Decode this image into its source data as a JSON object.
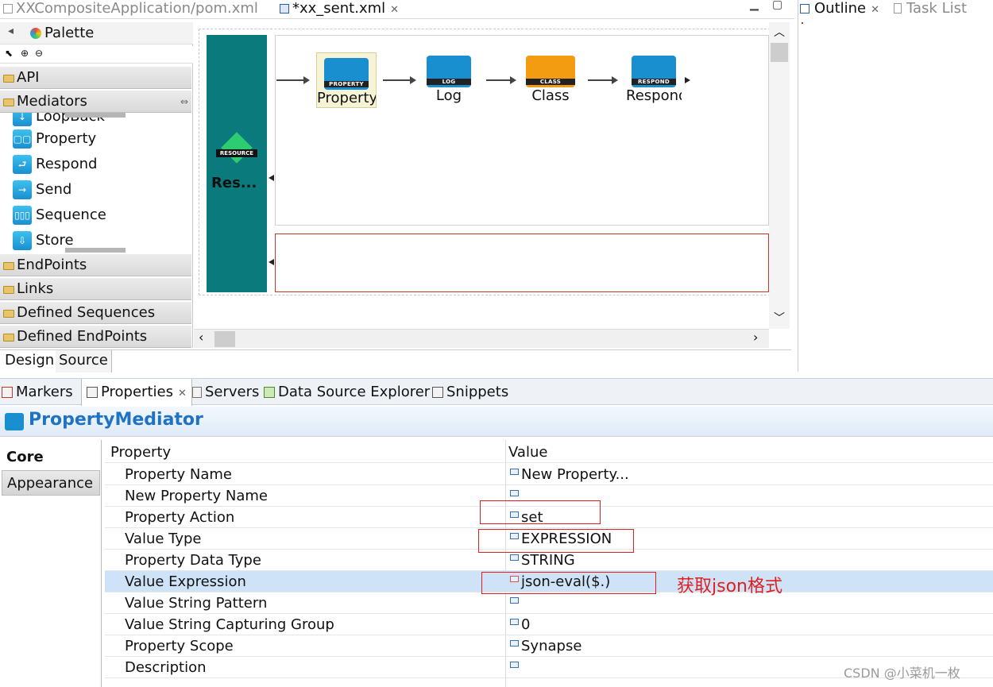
{
  "editor_tabs": [
    {
      "label": "XXCompositeApplication/pom.xml",
      "active": false
    },
    {
      "label": "*xx_sent.xml",
      "active": true
    }
  ],
  "palette": {
    "title": "Palette",
    "drawers": {
      "api": "API",
      "mediators": "Mediators",
      "endpoints": "EndPoints",
      "links": "Links",
      "defined_sequences": "Defined Sequences",
      "defined_endpoints": "Defined EndPoints"
    },
    "items": [
      "LoopBack",
      "Property",
      "Respond",
      "Send",
      "Sequence",
      "Store"
    ]
  },
  "canvas": {
    "resource_label": "Res...",
    "resource_tag": "RESOURCE",
    "mediators": [
      {
        "label": "Property",
        "tag": "PROPERTY",
        "color": "#1a8fd0"
      },
      {
        "label": "Log",
        "tag": "LOG",
        "color": "#1a8fd0"
      },
      {
        "label": "Class",
        "tag": "CLASS",
        "color": "#f39c12"
      },
      {
        "label": "Respond",
        "tag": "RESPOND",
        "color": "#1a8fd0"
      }
    ]
  },
  "design_tabs": {
    "design": "Design",
    "source": "Source"
  },
  "outline_tabs": {
    "outline": "Outline",
    "task_list": "Task List"
  },
  "views": [
    "Markers",
    "Properties",
    "Servers",
    "Data Source Explorer",
    "Snippets"
  ],
  "property_panel": {
    "title": "PropertyMediator",
    "tabs": {
      "core": "Core",
      "appearance": "Appearance"
    },
    "headers": {
      "property": "Property",
      "value": "Value"
    },
    "rows": [
      {
        "name": "Property Name",
        "value": "New Property..."
      },
      {
        "name": "New Property Name",
        "value": ""
      },
      {
        "name": "Property Action",
        "value": "set"
      },
      {
        "name": "Value Type",
        "value": "EXPRESSION"
      },
      {
        "name": "Property Data Type",
        "value": "STRING"
      },
      {
        "name": "Value Expression",
        "value": "json-eval($.)"
      },
      {
        "name": "Value String Pattern",
        "value": ""
      },
      {
        "name": "Value String Capturing Group",
        "value": "0"
      },
      {
        "name": "Property Scope",
        "value": "Synapse"
      },
      {
        "name": "Description",
        "value": ""
      }
    ]
  },
  "annotation": "获取json格式",
  "watermark": "CSDN @小菜机一枚",
  "colors": {
    "resource_teal": "#0a7a7d",
    "accent_blue": "#1f73c4",
    "annotation_red": "#e02020",
    "selection": "#cfe3f8"
  }
}
